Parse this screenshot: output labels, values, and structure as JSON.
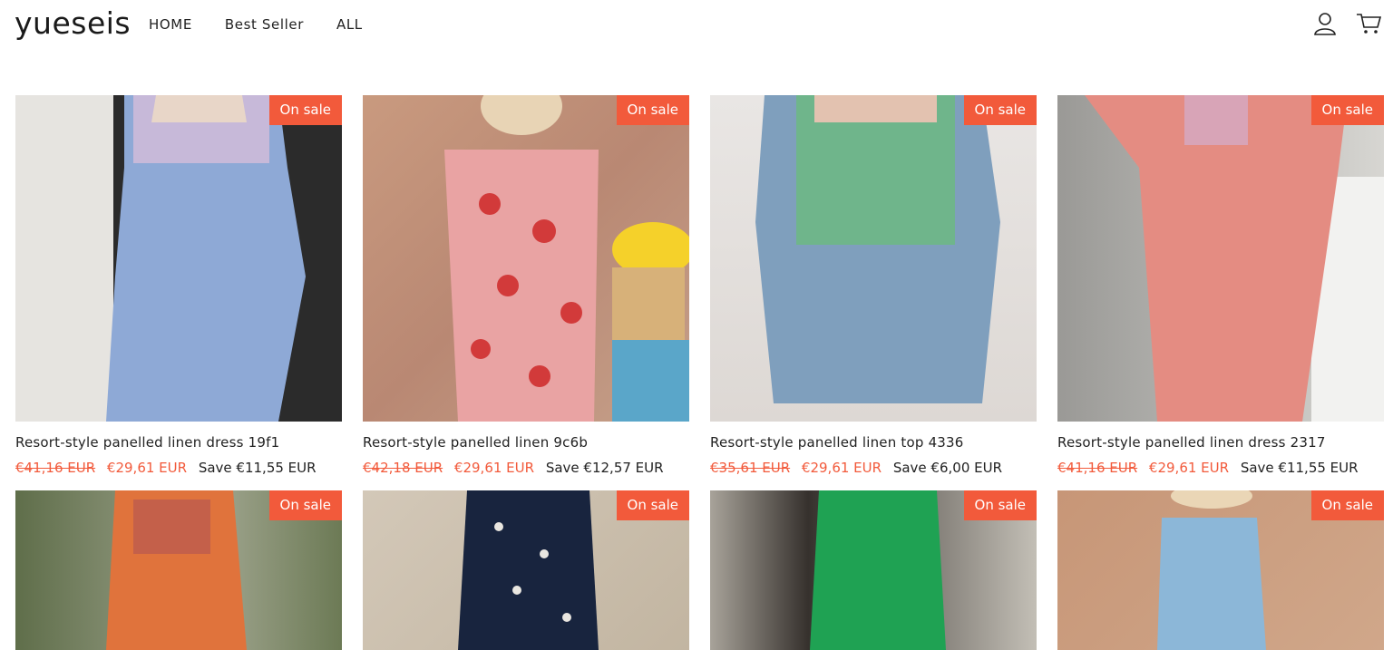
{
  "brand": {
    "logo": "yueseis"
  },
  "nav": {
    "items": [
      "HOME",
      "Best Seller",
      "ALL"
    ]
  },
  "header_icons": [
    "user-icon",
    "cart-icon"
  ],
  "colors": {
    "sale": "#f25a3b",
    "text": "#222222",
    "background": "#ffffff"
  },
  "products": [
    {
      "badge": "On sale",
      "title": "Resort-style panelled linen dress 19f1",
      "price_old": "€41,16 EUR",
      "price_new": "€29,61 EUR",
      "save": "Save €11,55 EUR"
    },
    {
      "badge": "On sale",
      "title": "Resort-style panelled linen 9c6b",
      "price_old": "€42,18 EUR",
      "price_new": "€29,61 EUR",
      "save": "Save €12,57 EUR"
    },
    {
      "badge": "On sale",
      "title": "Resort-style panelled linen top 4336",
      "price_old": "€35,61 EUR",
      "price_new": "€29,61 EUR",
      "save": "Save €6,00 EUR"
    },
    {
      "badge": "On sale",
      "title": "Resort-style panelled linen dress 2317",
      "price_old": "€41,16 EUR",
      "price_new": "€29,61 EUR",
      "save": "Save €11,55 EUR"
    },
    {
      "badge": "On sale"
    },
    {
      "badge": "On sale"
    },
    {
      "badge": "On sale"
    },
    {
      "badge": "On sale"
    }
  ]
}
